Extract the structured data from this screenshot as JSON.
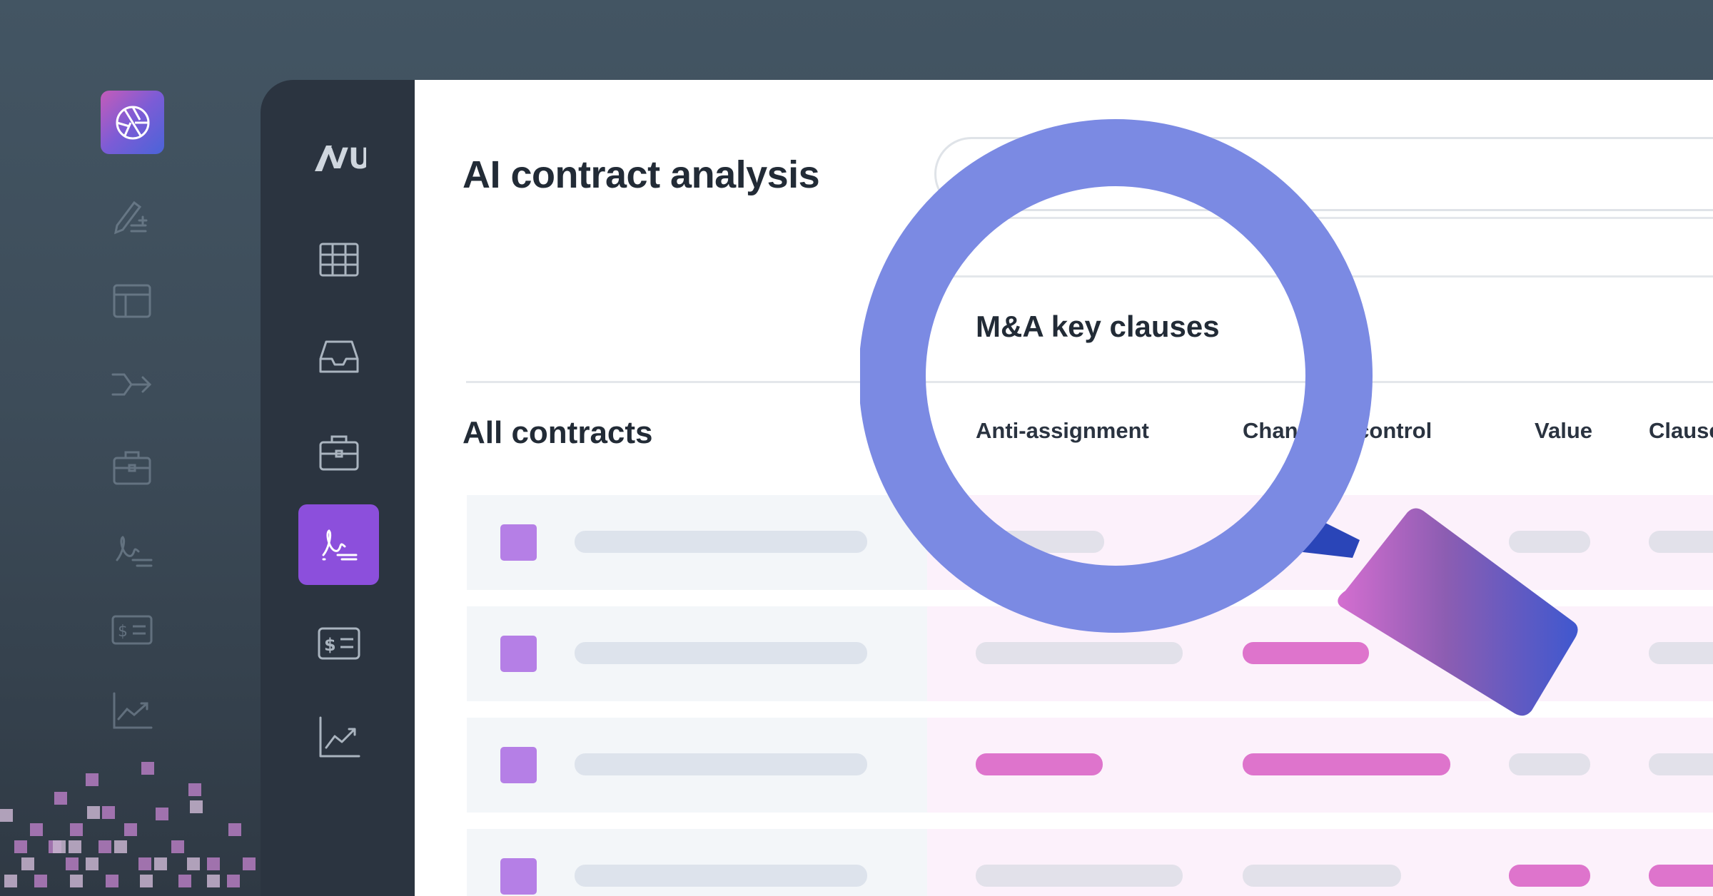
{
  "app": {
    "title": "AI contract analysis",
    "brand_logo_text": "VU"
  },
  "main": {
    "section_title": "All contracts",
    "column_group_title": "M&A key clauses",
    "columns": [
      "Anti-assignment",
      "Change of control",
      "Value",
      "Clause"
    ],
    "rows": [
      {
        "checked": true,
        "cells": [
          "grey",
          "empty",
          "grey",
          "grey"
        ]
      },
      {
        "checked": true,
        "cells": [
          "grey",
          "pink",
          "empty",
          "grey"
        ]
      },
      {
        "checked": true,
        "cells": [
          "pink",
          "pink",
          "grey",
          "grey"
        ]
      },
      {
        "checked": true,
        "cells": [
          "grey",
          "grey",
          "pink",
          "pink"
        ]
      }
    ]
  },
  "sidebar": {
    "items": [
      {
        "icon": "grid-icon"
      },
      {
        "icon": "inbox-icon"
      },
      {
        "icon": "briefcase-icon"
      },
      {
        "icon": "signature-icon",
        "active": true
      },
      {
        "icon": "invoice-icon"
      },
      {
        "icon": "chart-icon"
      }
    ]
  },
  "colors": {
    "accent": "#8c4fdc",
    "magnifier_ring": "#7b8ae3",
    "highlight_pink": "#de74cc",
    "sidebar_bg": "#2b3440"
  }
}
